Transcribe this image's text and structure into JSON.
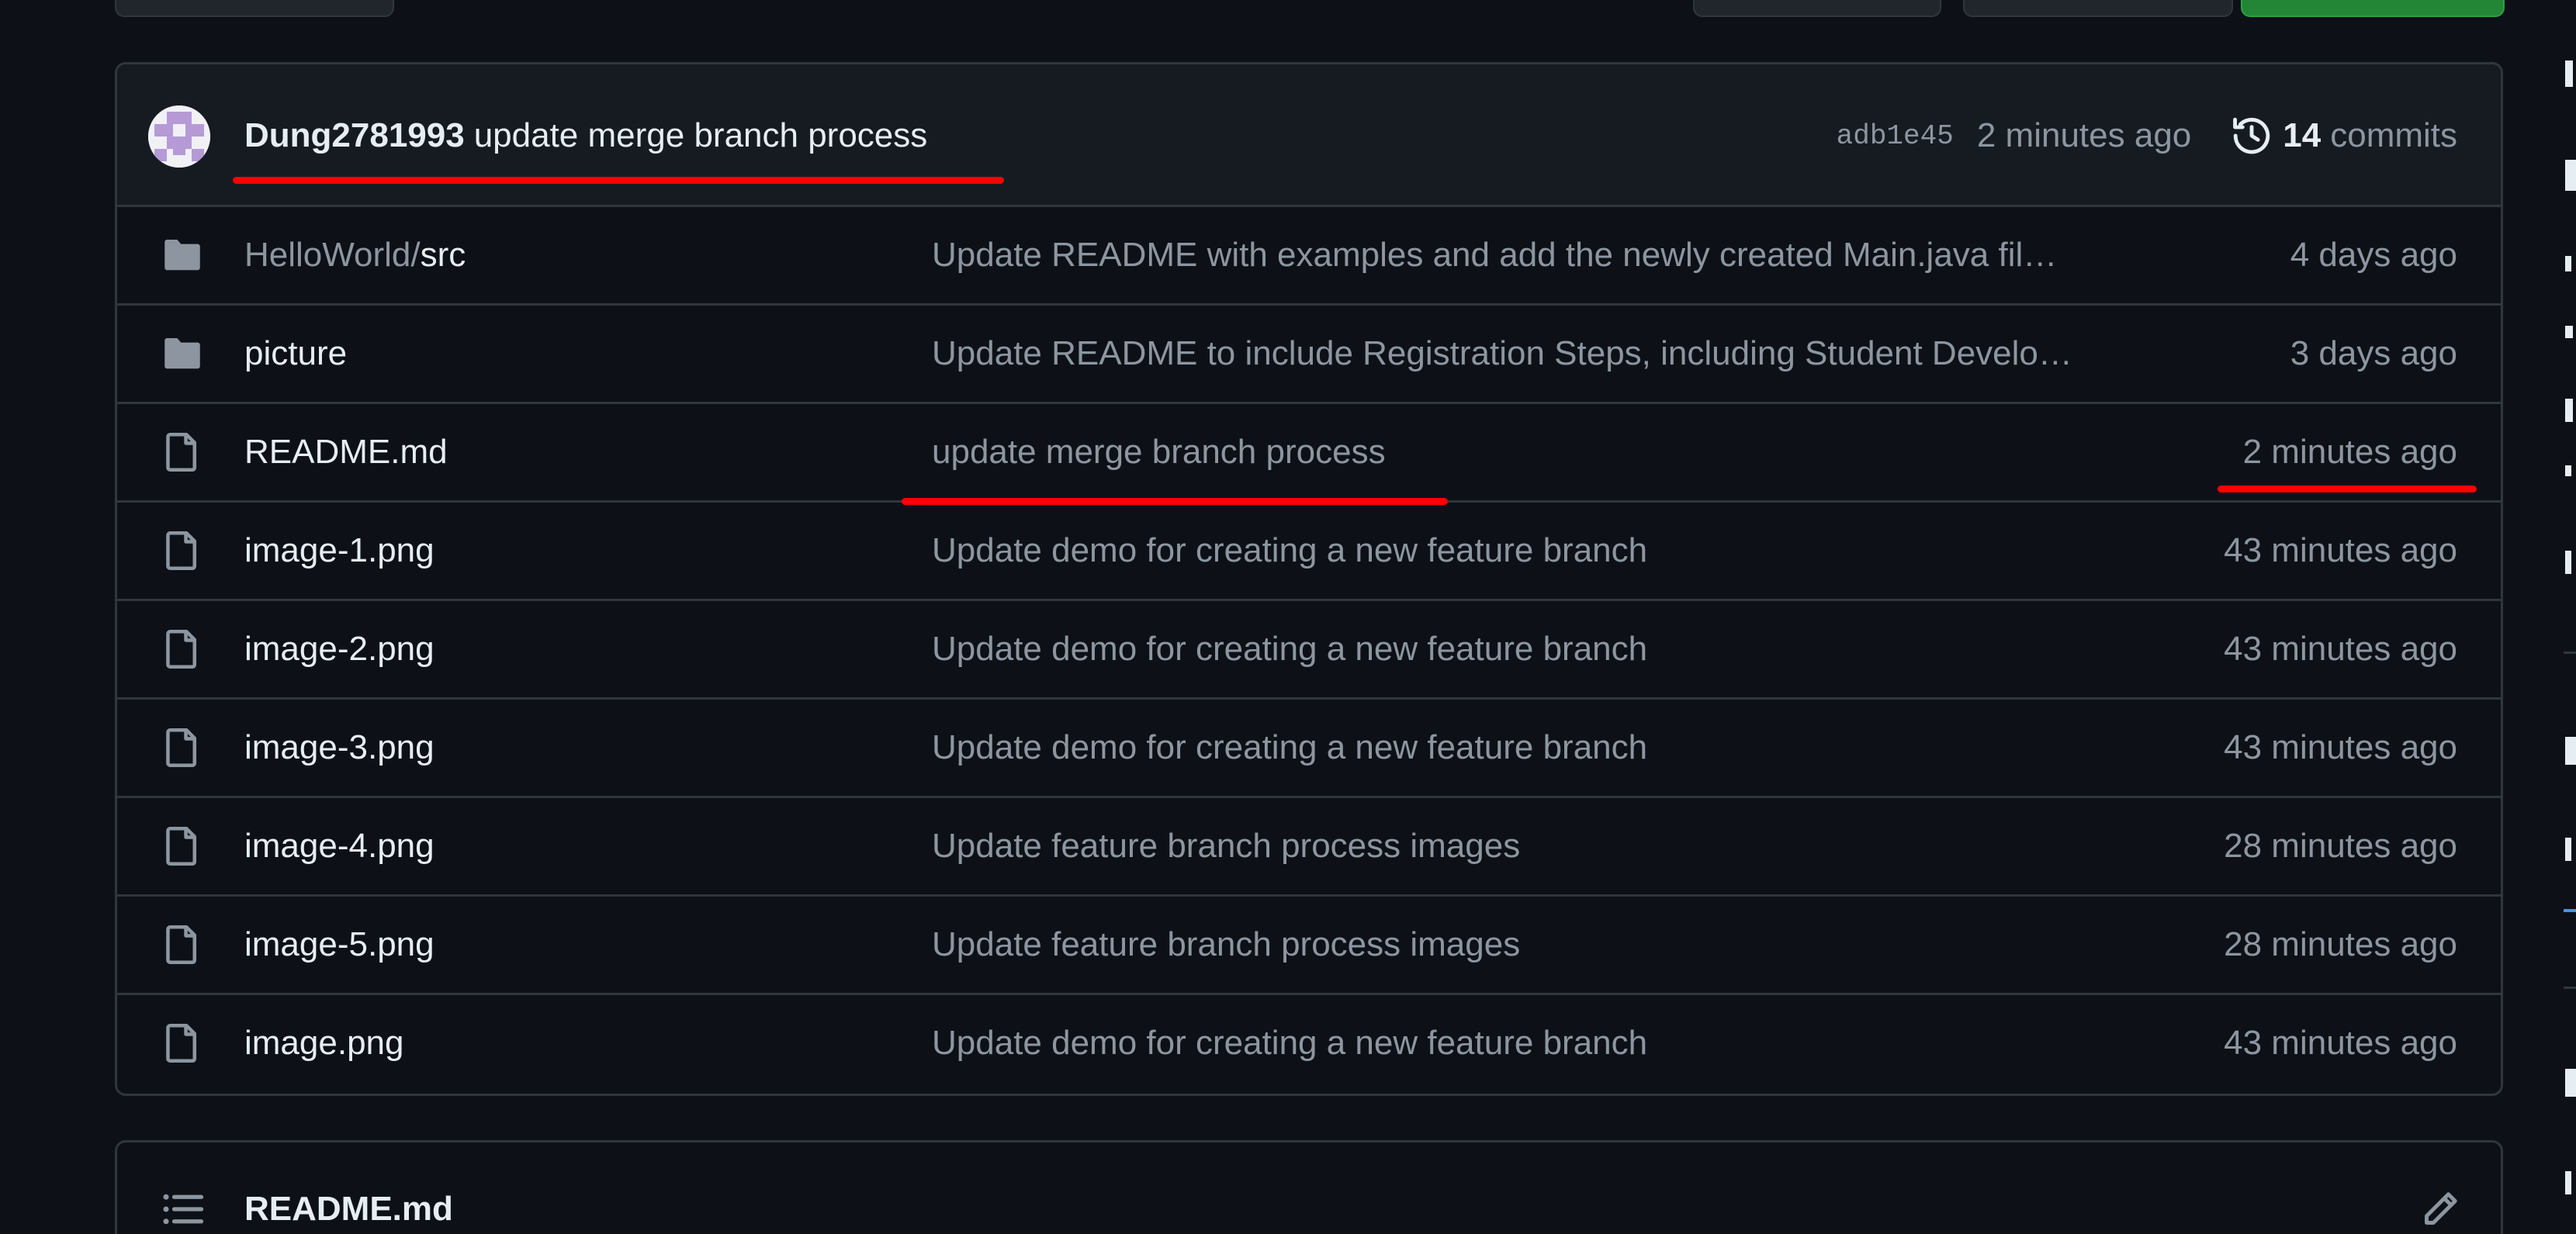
{
  "latest_commit": {
    "author": "Dung2781993",
    "message": "update merge branch process",
    "sha": "adb1e45",
    "time": "2 minutes ago",
    "commits_count": "14",
    "commits_label": "commits"
  },
  "files": [
    {
      "type": "folder",
      "name_prefix": "HelloWorld/",
      "name": "src",
      "message": "Update README with examples and add the newly created Main.java fil…",
      "time": "4 days ago"
    },
    {
      "type": "folder",
      "name_prefix": "",
      "name": "picture",
      "message": "Update README to include Registration Steps, including Student Develo…",
      "time": "3 days ago"
    },
    {
      "type": "file",
      "name_prefix": "",
      "name": "README.md",
      "message": "update merge branch process",
      "time": "2 minutes ago"
    },
    {
      "type": "file",
      "name_prefix": "",
      "name": "image-1.png",
      "message": "Update demo for creating a new feature branch",
      "time": "43 minutes ago"
    },
    {
      "type": "file",
      "name_prefix": "",
      "name": "image-2.png",
      "message": "Update demo for creating a new feature branch",
      "time": "43 minutes ago"
    },
    {
      "type": "file",
      "name_prefix": "",
      "name": "image-3.png",
      "message": "Update demo for creating a new feature branch",
      "time": "43 minutes ago"
    },
    {
      "type": "file",
      "name_prefix": "",
      "name": "image-4.png",
      "message": "Update feature branch process images",
      "time": "28 minutes ago"
    },
    {
      "type": "file",
      "name_prefix": "",
      "name": "image-5.png",
      "message": "Update feature branch process images",
      "time": "28 minutes ago"
    },
    {
      "type": "file",
      "name_prefix": "",
      "name": "image.png",
      "message": "Update demo for creating a new feature branch",
      "time": "43 minutes ago"
    }
  ],
  "readme": {
    "title": "README.md"
  },
  "icons": {
    "folder": "folder-icon",
    "file": "file-icon",
    "history": "history-icon",
    "list": "list-icon",
    "edit": "pencil-icon",
    "avatar": "identicon-avatar"
  },
  "colors": {
    "background": "#0d1117",
    "header_background": "#161b22",
    "border": "#30363d",
    "text": "#e6edf3",
    "muted_text": "#8d96a0",
    "annotation": "#ff0000",
    "primary_button": "#238636"
  }
}
